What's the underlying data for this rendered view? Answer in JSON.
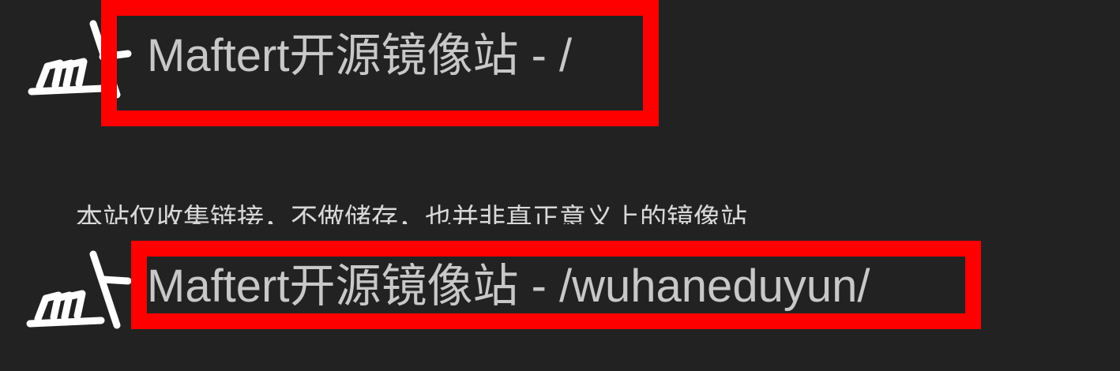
{
  "header_top": {
    "logo_icon": "maftert-logo-icon",
    "title": "Maftert开源镜像站 - /"
  },
  "notice": {
    "text": "本站仅收集链接，不做储存，也并非真正意义上的镜像站"
  },
  "header_bottom": {
    "logo_icon": "maftert-logo-icon",
    "title": "Maftert开源镜像站 - /wuhaneduyun/"
  },
  "colors": {
    "background": "#222222",
    "title_text": "#c8c8c8",
    "highlight": "#ff0000",
    "logo": "#ffffff"
  }
}
